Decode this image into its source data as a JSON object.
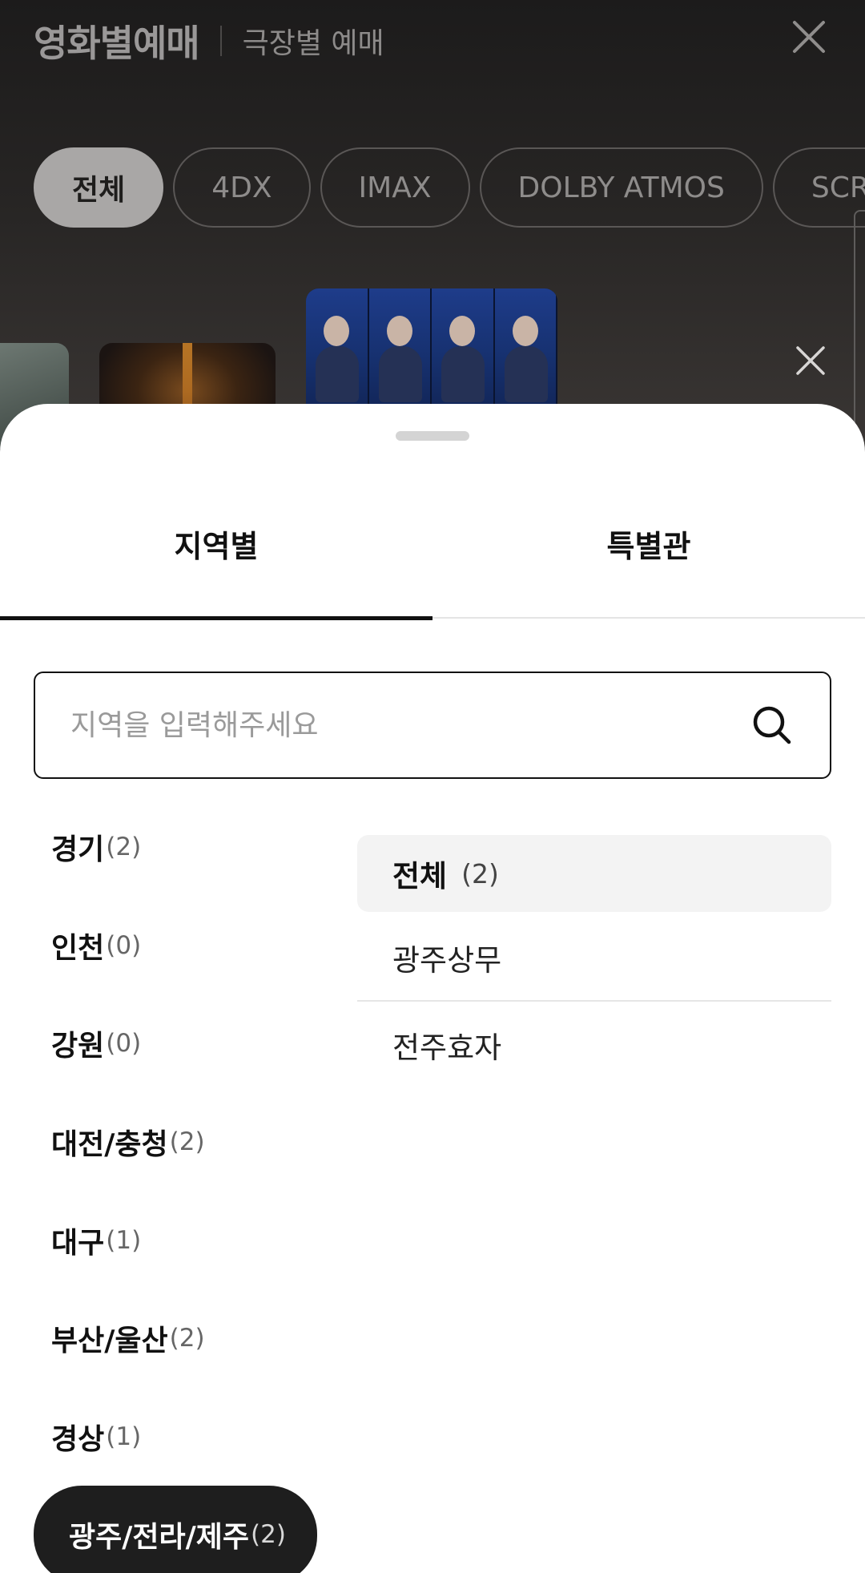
{
  "background": {
    "title": "영화별예매",
    "subtitle": "극장별 예매",
    "close_icon": "close-icon",
    "filter_chips": [
      {
        "label": "전체",
        "active": true
      },
      {
        "label": "4DX",
        "active": false
      },
      {
        "label": "IMAX",
        "active": false
      },
      {
        "label": "DOLBY ATMOS",
        "active": false
      },
      {
        "label": "SCREENX",
        "active": false
      }
    ]
  },
  "sheet": {
    "tabs": [
      {
        "label": "지역별",
        "active": true
      },
      {
        "label": "특별관",
        "active": false
      }
    ],
    "search": {
      "placeholder": "지역을 입력해주세요",
      "value": "",
      "icon": "search-icon"
    },
    "regions": [
      {
        "name": "경기",
        "count": "(2)",
        "active": false
      },
      {
        "name": "인천",
        "count": "(0)",
        "active": false
      },
      {
        "name": "강원",
        "count": "(0)",
        "active": false
      },
      {
        "name": "대전/충청",
        "count": "(2)",
        "active": false
      },
      {
        "name": "대구",
        "count": "(1)",
        "active": false
      },
      {
        "name": "부산/울산",
        "count": "(2)",
        "active": false
      },
      {
        "name": "경상",
        "count": "(1)",
        "active": false
      },
      {
        "name": "광주/전라/제주",
        "count": "(2)",
        "active": true
      }
    ],
    "theaters": [
      {
        "name": "전체",
        "count": "(2)",
        "active": true
      },
      {
        "name": "광주상무",
        "count": "",
        "active": false
      },
      {
        "name": "전주효자",
        "count": "",
        "active": false
      }
    ]
  },
  "colors": {
    "selected_region_bg": "#1e1e1e",
    "selected_theater_bg": "#f3f3f3",
    "active_tab_underline": "#111111"
  }
}
